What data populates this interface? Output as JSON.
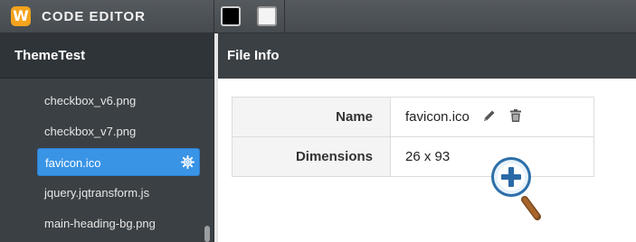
{
  "app": {
    "logo_letter": "W",
    "title": "CODE EDITOR",
    "swatches": [
      {
        "name": "black",
        "color": "#000000"
      },
      {
        "name": "white",
        "color": "#f4f4f4"
      }
    ]
  },
  "sidebar": {
    "title": "ThemeTest",
    "items": [
      {
        "label": "checkbox_v6.png",
        "active": false
      },
      {
        "label": "checkbox_v7.png",
        "active": false
      },
      {
        "label": "favicon.ico",
        "active": true,
        "icon": "gear-icon"
      },
      {
        "label": "jquery.jqtransform.js",
        "active": false
      },
      {
        "label": "main-heading-bg.png",
        "active": false
      }
    ]
  },
  "main": {
    "title": "File Info",
    "rows": [
      {
        "label": "Name",
        "value": "favicon.ico",
        "actions": [
          "pencil-icon",
          "trash-icon"
        ]
      },
      {
        "label": "Dimensions",
        "value": "26 x 93"
      }
    ],
    "zoom_icon": "zoom-in-icon"
  },
  "colors": {
    "accent": "#3a94e6",
    "logo": "#f4a31d",
    "sidebar_bg": "#3b4044"
  }
}
